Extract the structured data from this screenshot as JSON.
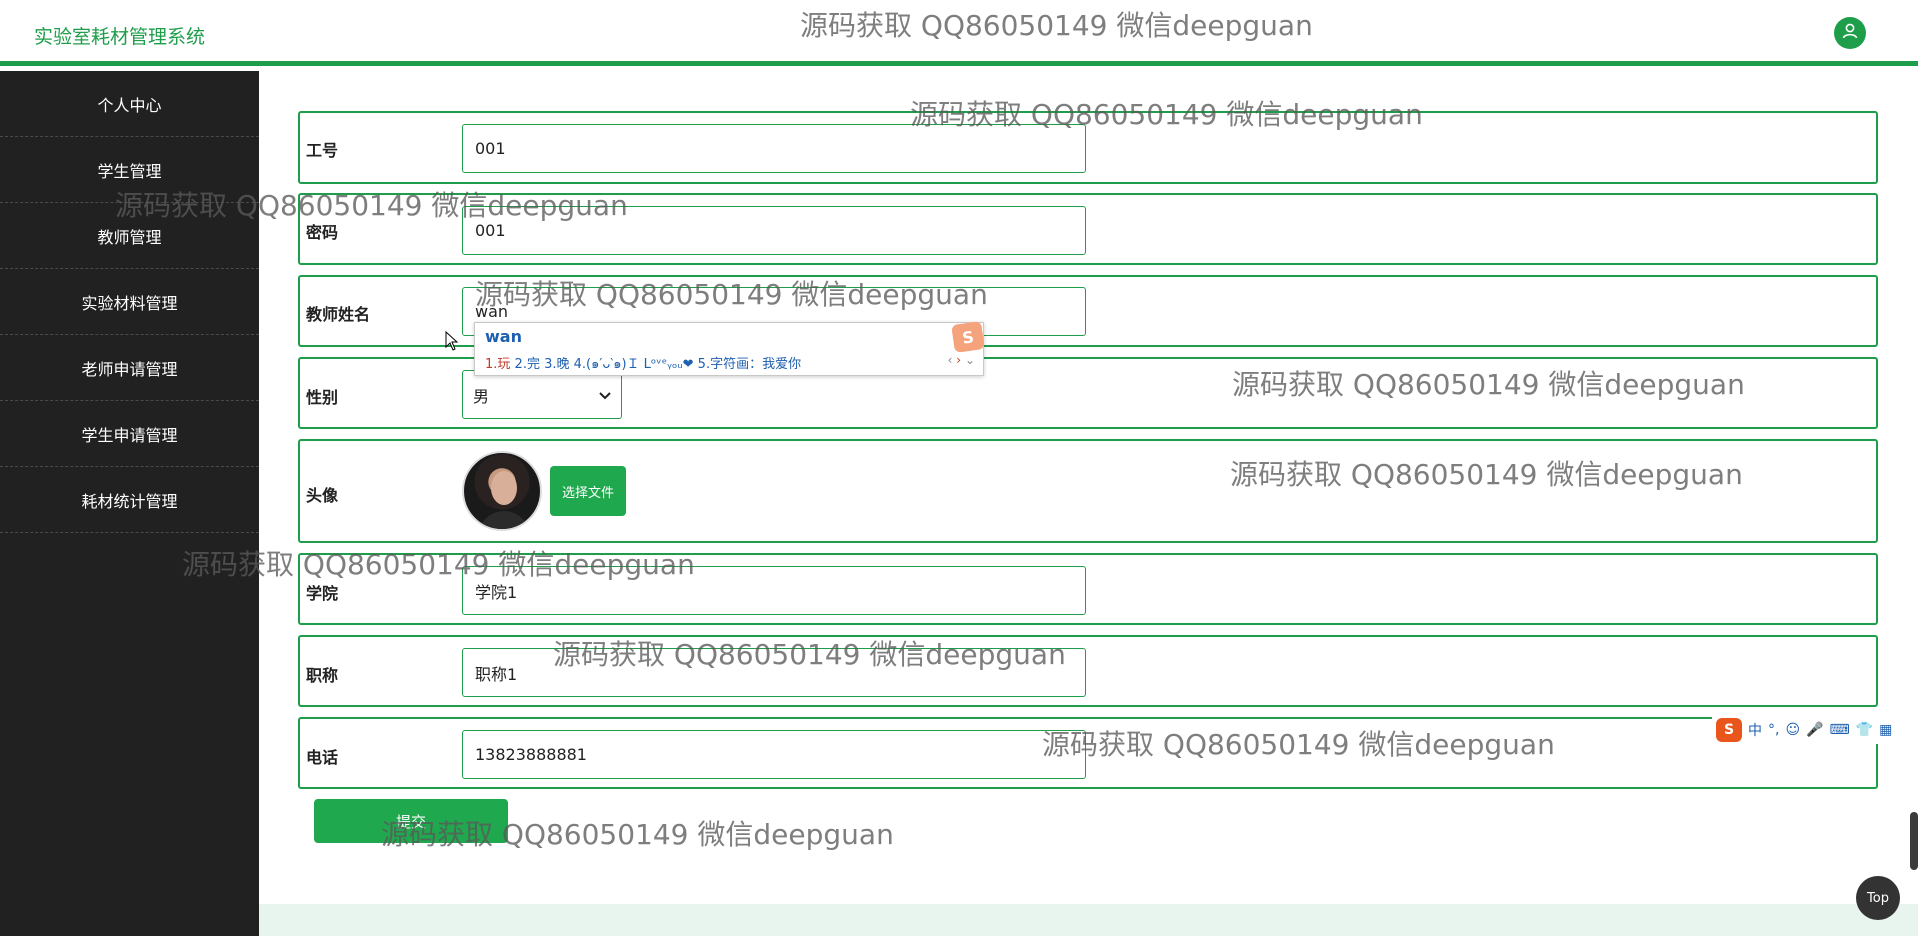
{
  "app_title": "实验室耗材管理系统",
  "icons": {
    "user": "user-icon",
    "select": "chevron-down-icon",
    "cursor": "mouse-pointer-icon"
  },
  "sidebar": {
    "items": [
      {
        "label": "个人中心"
      },
      {
        "label": "学生管理"
      },
      {
        "label": "教师管理"
      },
      {
        "label": "实验材料管理"
      },
      {
        "label": "老师申请管理"
      },
      {
        "label": "学生申请管理"
      },
      {
        "label": "耗材统计管理"
      }
    ]
  },
  "form": {
    "gonghao": {
      "label": "工号",
      "value": "001"
    },
    "mima": {
      "label": "密码",
      "value": "001"
    },
    "xingming": {
      "label": "教师姓名",
      "value": "wan"
    },
    "xingbie": {
      "label": "性别",
      "value": "男"
    },
    "touxiang": {
      "label": "头像",
      "button": "选择文件"
    },
    "xueyuan": {
      "label": "学院",
      "value": "学院1"
    },
    "zhicheng": {
      "label": "职称",
      "value": "职称1"
    },
    "dianhua": {
      "label": "电话",
      "value": "13823888881"
    },
    "submit": "提交"
  },
  "ime": {
    "composition": "wan",
    "candidates": [
      "1.玩",
      "2.完",
      "3.晚",
      "4.(๑′ᴗ‵๑)Ｉ Lᵒᵛᵉᵧₒᵤ❤",
      "5.字符画：我爱你"
    ],
    "logo": "S",
    "status_bar": [
      "S",
      "中",
      "°,",
      "☺",
      "🎤",
      "⌨",
      "👕",
      "▦"
    ]
  },
  "top_button": "Top",
  "watermark": "源码获取 QQ86050149 微信deepguan",
  "colors": {
    "accent": "#1e9e4a",
    "sidebar_bg": "#212121",
    "button": "#1fa84d"
  }
}
